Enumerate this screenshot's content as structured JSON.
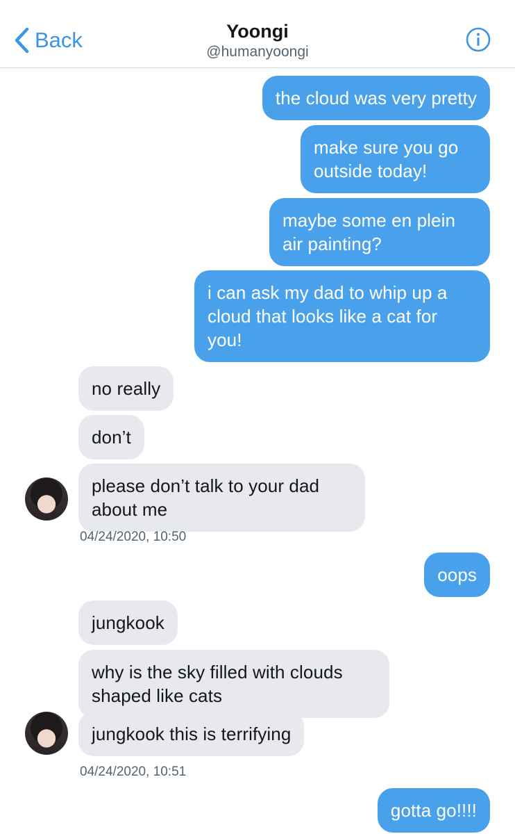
{
  "header": {
    "back_label": "Back",
    "contact_name": "Yoongi",
    "contact_handle": "@humanyoongi"
  },
  "messages": [
    {
      "direction": "out",
      "text": "the cloud was very pretty"
    },
    {
      "direction": "out",
      "text": "make sure you go outside today!"
    },
    {
      "direction": "out",
      "text": "maybe some en plein air painting?"
    },
    {
      "direction": "out",
      "text": "i can ask my dad to whip up a cloud that looks like a cat for you!"
    },
    {
      "direction": "in",
      "text": "no really"
    },
    {
      "direction": "in",
      "text": "don’t"
    },
    {
      "direction": "in",
      "text": "please don’t talk to your dad about me"
    },
    {
      "direction": "out",
      "text": "oops"
    },
    {
      "direction": "in",
      "text": "jungkook"
    },
    {
      "direction": "in",
      "text": "why is the sky filled with clouds shaped like cats"
    },
    {
      "direction": "in",
      "text": "jungkook this is terrifying"
    },
    {
      "direction": "out",
      "text": "gotta go!!!!"
    }
  ],
  "timestamps": [
    "04/24/2020, 10:50",
    "04/24/2020, 10:51"
  ],
  "colors": {
    "accent": "#1d9bf0",
    "outgoing_bubble": "#4aa1eb",
    "incoming_bubble": "#e7e9ee"
  }
}
